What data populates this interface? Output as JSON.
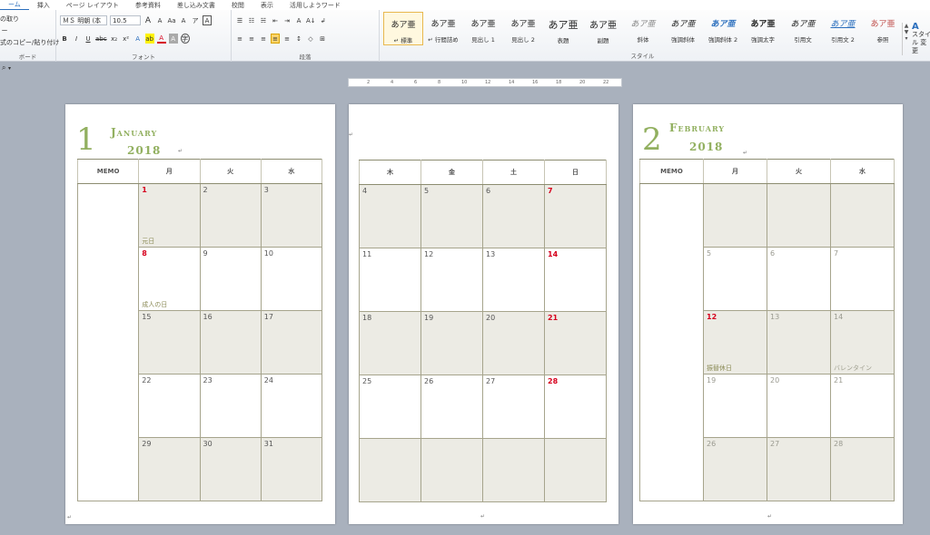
{
  "ribbon": {
    "tabs": [
      "ーム",
      "挿入",
      "ページ レイアウト",
      "参考資料",
      "差し込み文書",
      "校閲",
      "表示",
      "活用しようワード"
    ],
    "clipboard": {
      "cut": "の取り",
      "copy": "ー",
      "format_painter": "式のコピー/貼り付け",
      "label": "ボード"
    },
    "font": {
      "name": "ＭＳ 明朝 (本",
      "size": "10.5",
      "grow": "A",
      "shrink": "A",
      "case": "Aa",
      "clear": "A",
      "phonetic": "ア",
      "border_char": "A",
      "bold": "B",
      "italic": "I",
      "underline": "U",
      "strike": "abc",
      "subscript": "x₂",
      "superscript": "x²",
      "effects": "A",
      "highlight": "ab",
      "color": "A",
      "shade_char": "A",
      "enclose": "字",
      "label": "フォント"
    },
    "paragraph": {
      "bullets": "☰",
      "numbering": "☷",
      "multilevel": "☵",
      "decrease_indent": "⇤",
      "increase_indent": "⇥",
      "asian_layout": "A",
      "sort": "A↓",
      "show_marks": "↲",
      "align_left": "≡",
      "center": "≡",
      "align_right": "≡",
      "justify": "≡",
      "distributed": "≡",
      "line_spacing": "↕",
      "shading": "◇",
      "borders": "⊞",
      "label": "段落"
    },
    "styles": {
      "label": "スタイル",
      "items": [
        {
          "sample": "あア亜",
          "name": "↵ 標準"
        },
        {
          "sample": "あア亜",
          "name": "↵ 行間詰め"
        },
        {
          "sample": "あア亜",
          "name": "見出し 1"
        },
        {
          "sample": "あア亜",
          "name": "見出し 2"
        },
        {
          "sample": "あア亜",
          "name": "表題"
        },
        {
          "sample": "あア亜",
          "name": "副題"
        },
        {
          "sample": "あア亜",
          "name": "斜体"
        },
        {
          "sample": "あア亜",
          "name": "強調斜体"
        },
        {
          "sample": "あア亜",
          "name": "強調斜体 2"
        },
        {
          "sample": "あア亜",
          "name": "強調太字"
        },
        {
          "sample": "あア亜",
          "name": "引用文"
        },
        {
          "sample": "あア亜",
          "name": "引用文 2"
        },
        {
          "sample": "あア亜",
          "name": "参照"
        }
      ],
      "change_styles": "スタイル 変更"
    }
  },
  "colors": {
    "accent_green": "#92b060",
    "holiday_red": "#d6001c",
    "cell_shade": "#ecebe4"
  },
  "ruler": {
    "ticks": [
      "2",
      "4",
      "6",
      "8",
      "10",
      "12",
      "14",
      "16",
      "18",
      "20",
      "22"
    ]
  },
  "paragraph_mark": "↵",
  "pages": [
    {
      "month_number": "1",
      "month_name": "January",
      "year": "2018",
      "headers": [
        "MEMO",
        "月",
        "火",
        "水"
      ],
      "rows": [
        [
          {
            "n": "1",
            "red": true,
            "hol": "元日",
            "shade": true
          },
          {
            "n": "2",
            "shade": true
          },
          {
            "n": "3",
            "shade": true
          }
        ],
        [
          {
            "n": "8",
            "red": true,
            "hol": "成人の日"
          },
          {
            "n": "9"
          },
          {
            "n": "10"
          }
        ],
        [
          {
            "n": "15",
            "shade": true
          },
          {
            "n": "16",
            "shade": true
          },
          {
            "n": "17",
            "shade": true
          }
        ],
        [
          {
            "n": "22"
          },
          {
            "n": "23"
          },
          {
            "n": "24"
          }
        ],
        [
          {
            "n": "29",
            "shade": true
          },
          {
            "n": "30",
            "shade": true
          },
          {
            "n": "31",
            "shade": true
          }
        ]
      ]
    },
    {
      "headers": [
        "木",
        "金",
        "土",
        "日"
      ],
      "rows": [
        [
          {
            "n": "4",
            "shade": true
          },
          {
            "n": "5",
            "shade": true
          },
          {
            "n": "6",
            "shade": true
          },
          {
            "n": "7",
            "red": true,
            "shade": true
          }
        ],
        [
          {
            "n": "11"
          },
          {
            "n": "12"
          },
          {
            "n": "13"
          },
          {
            "n": "14",
            "red": true
          }
        ],
        [
          {
            "n": "18",
            "shade": true
          },
          {
            "n": "19",
            "shade": true
          },
          {
            "n": "20",
            "shade": true
          },
          {
            "n": "21",
            "red": true,
            "shade": true
          }
        ],
        [
          {
            "n": "25"
          },
          {
            "n": "26"
          },
          {
            "n": "27"
          },
          {
            "n": "28",
            "red": true
          }
        ],
        [
          {
            "n": "",
            "shade": true
          },
          {
            "n": "",
            "shade": true
          },
          {
            "n": "",
            "shade": true
          },
          {
            "n": "",
            "shade": true
          }
        ]
      ]
    },
    {
      "month_number": "2",
      "month_name": "February",
      "year": "2018",
      "headers": [
        "MEMO",
        "月",
        "火",
        "水"
      ],
      "rows": [
        [
          {
            "n": "",
            "shade": true
          },
          {
            "n": "",
            "shade": true
          },
          {
            "n": "",
            "shade": true
          }
        ],
        [
          {
            "n": "5",
            "gray": true
          },
          {
            "n": "6",
            "gray": true
          },
          {
            "n": "7",
            "gray": true
          }
        ],
        [
          {
            "n": "12",
            "red": true,
            "shade": true,
            "hol": "振替休日"
          },
          {
            "n": "13",
            "gray": true,
            "shade": true
          },
          {
            "n": "14",
            "gray": true,
            "shade": true,
            "hol": "バレンタイン"
          }
        ],
        [
          {
            "n": "19",
            "gray": true
          },
          {
            "n": "20",
            "gray": true
          },
          {
            "n": "21",
            "gray": true
          }
        ],
        [
          {
            "n": "26",
            "gray": true,
            "shade": true
          },
          {
            "n": "27",
            "gray": true,
            "shade": true
          },
          {
            "n": "28",
            "gray": true,
            "shade": true
          }
        ]
      ]
    }
  ]
}
